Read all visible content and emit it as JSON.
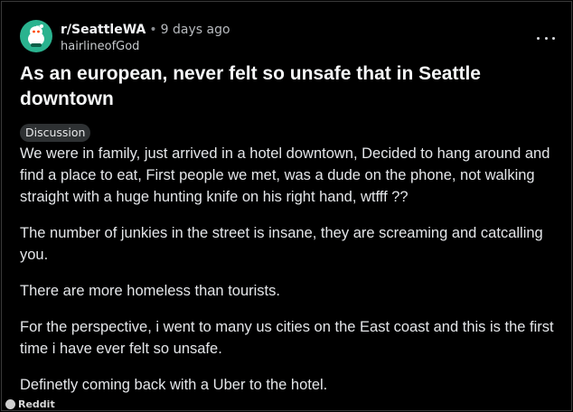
{
  "post": {
    "subreddit": "r/SeattleWA",
    "separator": "•",
    "time_ago": "9 days ago",
    "author": "hairlineofGod",
    "title": "As an european, never felt so unsafe that in Seattle downtown",
    "flair": "Discussion",
    "paragraphs": [
      "We were in family, just arrived in a hotel downtown, Decided to hang around and find a place to eat, First people we met, was a dude on the phone, not walking straight with a huge hunting knife on his right hand, wtfff ??",
      "The number of junkies in the street is insane, they are screaming and catcalling you.",
      "There are more homeless than tourists.",
      "For the perspective, i went to many us cities on the East coast and this is the first time i have ever felt so unsafe.",
      "Definetly coming back with a Uber to the hotel."
    ]
  },
  "icons": {
    "avatar": "subreddit-avatar-icon",
    "more": "more-options-icon",
    "watermark": "reddit-logo-icon"
  },
  "watermark": {
    "label": "Reddit"
  },
  "colors": {
    "background": "#000000",
    "avatar_bg": "#2ab38f",
    "flair_bg": "#2e3133",
    "text": "#e4e6e9"
  }
}
